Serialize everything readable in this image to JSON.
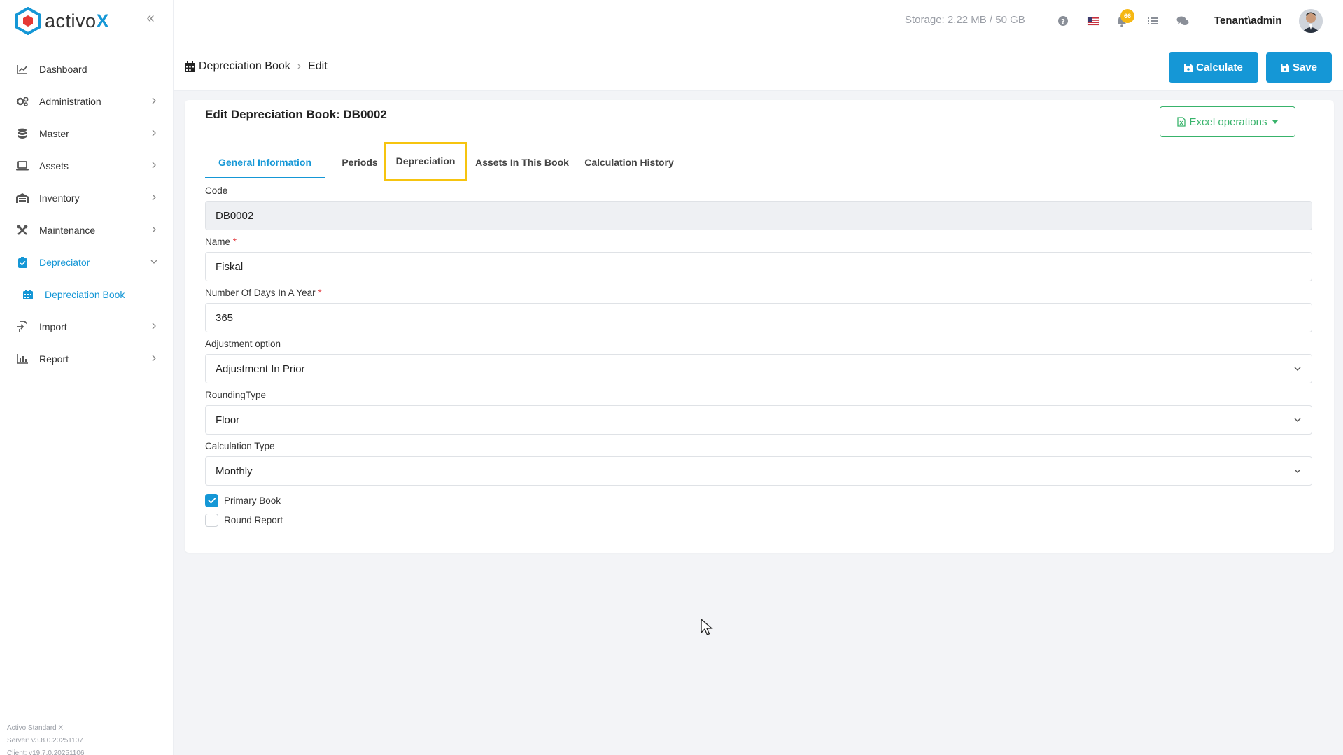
{
  "app": {
    "logo_text": "activo",
    "logo_x": "X",
    "brand_color": "#1597d6"
  },
  "sidebar": {
    "items": [
      {
        "label": "Dashboard",
        "icon": "chart-line-icon"
      },
      {
        "label": "Administration",
        "icon": "gears-icon"
      },
      {
        "label": "Master",
        "icon": "database-icon"
      },
      {
        "label": "Assets",
        "icon": "laptop-icon"
      },
      {
        "label": "Inventory",
        "icon": "warehouse-icon"
      },
      {
        "label": "Maintenance",
        "icon": "tools-icon"
      },
      {
        "label": "Depreciator",
        "icon": "clipboard-icon"
      },
      {
        "label": "Import",
        "icon": "file-import-icon"
      },
      {
        "label": "Report",
        "icon": "bar-chart-icon"
      }
    ],
    "sub_item": {
      "label": "Depreciation Book",
      "icon": "calendar-icon"
    },
    "footer": {
      "product": "Activo Standard X",
      "server": "Server: v3.8.0.20251107",
      "client": "Client: v19.7.0.20251106"
    }
  },
  "topbar": {
    "storage": "Storage: 2.22 MB / 50 GB",
    "notification_count": "66",
    "user": "Tenant\\admin"
  },
  "header": {
    "breadcrumb_root": "Depreciation Book",
    "breadcrumb_current": "Edit",
    "calculate_label": "Calculate",
    "save_label": "Save"
  },
  "card": {
    "title": "Edit Depreciation Book: DB0002",
    "excel_label": "Excel operations",
    "tabs": [
      "General Information",
      "Periods",
      "Depreciation",
      "Assets In This Book",
      "Calculation History"
    ],
    "active_tab": "General Information",
    "highlighted_tab": "Depreciation"
  },
  "form": {
    "code_label": "Code",
    "code_value": "DB0002",
    "name_label": "Name",
    "name_value": "Fiskal",
    "days_label": "Number Of Days In A Year",
    "days_value": "365",
    "adjustment_label": "Adjustment option",
    "adjustment_value": "Adjustment In Prior",
    "rounding_label": "RoundingType",
    "rounding_value": "Floor",
    "calc_type_label": "Calculation Type",
    "calc_type_value": "Monthly",
    "primary_book_label": "Primary Book",
    "primary_book_checked": true,
    "round_report_label": "Round Report",
    "round_report_checked": false,
    "required_mark": "*"
  }
}
